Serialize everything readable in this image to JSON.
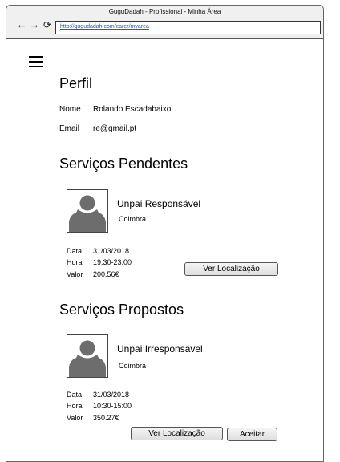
{
  "browser": {
    "title": "GuguDadah - Profissional - Minha Área",
    "url": "http://gugudadah.com/carer/myarea"
  },
  "profile": {
    "heading": "Perfil",
    "name_label": "Nome",
    "name_value": "Rolando Escadabaixo",
    "email_label": "Email",
    "email_value": "re@gmail.pt"
  },
  "pending": {
    "heading": "Serviços Pendentes",
    "name": "Unpai Responsável",
    "city": "Coimbra",
    "date_label": "Data",
    "date_value": "31/03/2018",
    "time_label": "Hora",
    "time_value": "19:30-23:00",
    "price_label": "Valor",
    "price_value": "200.56€",
    "location_button": "Ver Localização"
  },
  "proposed": {
    "heading": "Serviços Propostos",
    "name": "Unpai Irresponsável",
    "city": "Coimbra",
    "date_label": "Data",
    "date_value": "31/03/2018",
    "time_label": "Hora",
    "time_value": "10:30-15:00",
    "price_label": "Valor",
    "price_value": "350.27€",
    "location_button": "Ver Localização",
    "accept_button": "Aceitar"
  }
}
